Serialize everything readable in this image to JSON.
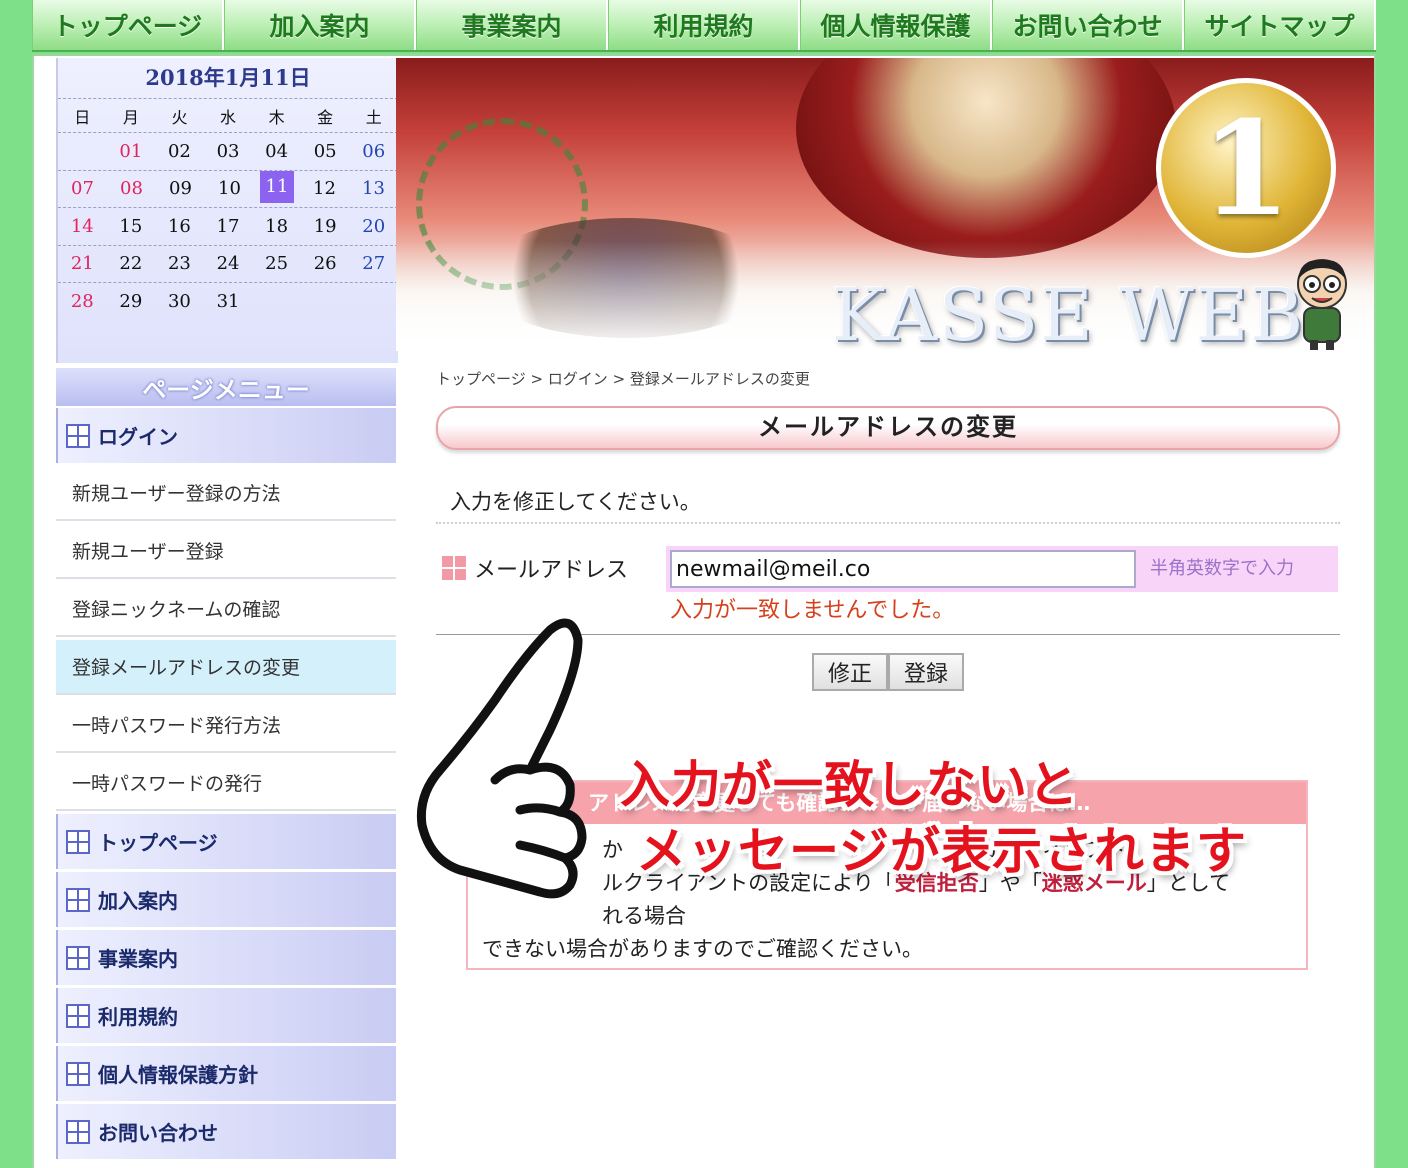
{
  "nav": {
    "items": [
      "トップページ",
      "加入案内",
      "事業案内",
      "利用規約",
      "個人情報保護",
      "お問い合わせ",
      "サイトマップ"
    ]
  },
  "calendar": {
    "title": "2018年1月11日",
    "weekdays": [
      "日",
      "月",
      "火",
      "水",
      "木",
      "金",
      "土"
    ],
    "weeks": [
      [
        "",
        "01",
        "02",
        "03",
        "04",
        "05",
        "06"
      ],
      [
        "07",
        "08",
        "09",
        "10",
        "11",
        "12",
        "13"
      ],
      [
        "14",
        "15",
        "16",
        "17",
        "18",
        "19",
        "20"
      ],
      [
        "21",
        "22",
        "23",
        "24",
        "25",
        "26",
        "27"
      ],
      [
        "28",
        "29",
        "30",
        "31",
        "",
        "",
        ""
      ]
    ],
    "today": "11",
    "holidays": [
      "01",
      "08"
    ]
  },
  "menu": {
    "heading": "ページメニュー",
    "items": [
      {
        "type": "section",
        "label": "ログイン"
      },
      {
        "type": "sub",
        "label": "新規ユーザー登録の方法"
      },
      {
        "type": "sub",
        "label": "新規ユーザー登録"
      },
      {
        "type": "sub",
        "label": "登録ニックネームの確認"
      },
      {
        "type": "sub",
        "label": "登録メールアドレスの変更",
        "active": true
      },
      {
        "type": "sub",
        "label": "一時パスワード発行方法"
      },
      {
        "type": "sub",
        "label": "一時パスワードの発行"
      },
      {
        "type": "section",
        "label": "トップページ"
      },
      {
        "type": "section",
        "label": "加入案内"
      },
      {
        "type": "section",
        "label": "事業案内"
      },
      {
        "type": "section",
        "label": "利用規約"
      },
      {
        "type": "section",
        "label": "個人情報保護方針"
      },
      {
        "type": "section",
        "label": "お問い合わせ"
      }
    ]
  },
  "banner": {
    "medal": "1",
    "logo": "KASSE WEB"
  },
  "breadcrumb": "トップページ > ログイン > 登録メールアドレスの変更",
  "page_title": "メールアドレスの変更",
  "instruction": "入力を修正してください。",
  "form": {
    "label": "メールアドレス",
    "value": "newmail@meil.co",
    "hint": "半角英数字で入力",
    "error": "入力が一致しませんでした。"
  },
  "buttons": {
    "fix": "修正",
    "register": "登録"
  },
  "notice": {
    "heading": "アドレスを変更しても確認メールが届かない場合は…",
    "line1": "か　　　　　　　　　　　　　　　　キュリティソフト",
    "line2_a": "ルクライアントの設定により「",
    "line2_em1": "受信拒否",
    "line2_b": "」や「",
    "line2_em2": "迷惑メール",
    "line2_c": "」として",
    "line3": "れる場合",
    "line4": "できない場合がありますのでご確認ください。"
  },
  "overlay": {
    "line1": "入力が一致しないと",
    "line2": "メッセージが表示されます"
  },
  "colors": {
    "background": "#7fe08a",
    "nav_text": "#1f7a1f",
    "error": "#d6401c",
    "overlay": "#e4121d",
    "today": "#8b63f0"
  }
}
